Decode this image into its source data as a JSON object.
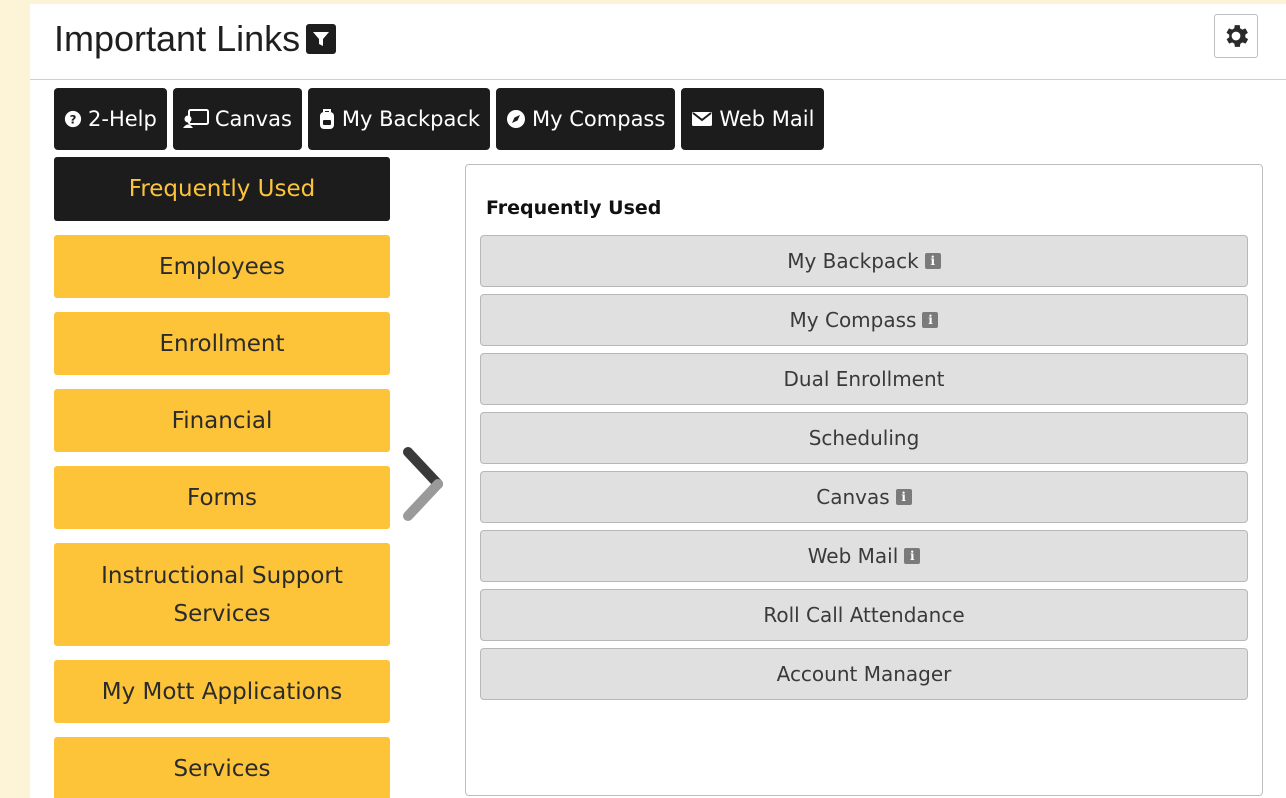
{
  "header": {
    "title": "Important Links"
  },
  "quick_links": [
    {
      "label": "2-Help",
      "icon": "question-circle-icon"
    },
    {
      "label": "Canvas",
      "icon": "canvas-icon"
    },
    {
      "label": "My Backpack",
      "icon": "backpack-icon"
    },
    {
      "label": "My Compass",
      "icon": "compass-icon"
    },
    {
      "label": "Web Mail",
      "icon": "envelope-icon"
    }
  ],
  "categories": [
    {
      "label": "Frequently Used",
      "active": true
    },
    {
      "label": "Employees"
    },
    {
      "label": "Enrollment"
    },
    {
      "label": "Financial"
    },
    {
      "label": "Forms"
    },
    {
      "label": "Instructional Support Services"
    },
    {
      "label": "My Mott Applications"
    },
    {
      "label": "Services"
    }
  ],
  "content": {
    "title": "Frequently Used",
    "links": [
      {
        "label": "My Backpack",
        "info": true
      },
      {
        "label": "My Compass",
        "info": true
      },
      {
        "label": "Dual Enrollment",
        "info": false
      },
      {
        "label": "Scheduling",
        "info": false
      },
      {
        "label": "Canvas",
        "info": true
      },
      {
        "label": "Web Mail",
        "info": true
      },
      {
        "label": "Roll Call Attendance",
        "info": false
      },
      {
        "label": "Account Manager",
        "info": false
      }
    ]
  },
  "colors": {
    "accent": "#fdc43a",
    "dark": "#1c1c1c",
    "background": "#fdf3d6"
  }
}
